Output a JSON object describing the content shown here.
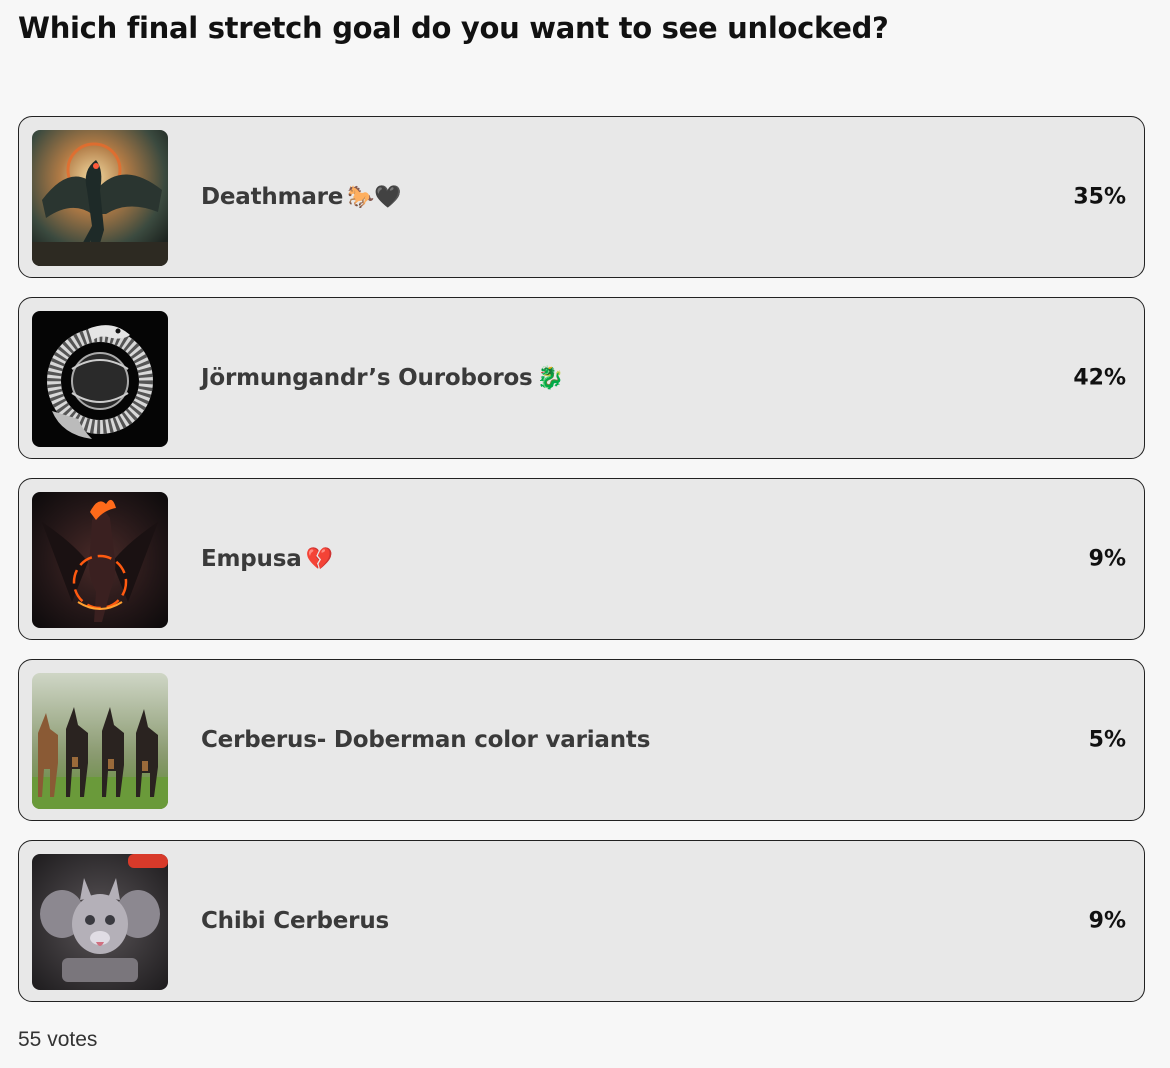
{
  "poll": {
    "question": "Which final stretch goal do you want to see unlocked?",
    "options": [
      {
        "label": "Deathmare",
        "emoji": "🐎🖤",
        "percent": "35%",
        "image": "winged-dark-horse-image"
      },
      {
        "label": "Jörmungandr’s Ouroboros",
        "emoji": "🐉",
        "percent": "42%",
        "image": "serpent-ouroboros-image"
      },
      {
        "label": "Empusa",
        "emoji": "💔",
        "percent": "9%",
        "image": "fiery-demon-woman-image"
      },
      {
        "label": "Cerberus- Doberman color variants",
        "emoji": "",
        "percent": "5%",
        "image": "doberman-dogs-image"
      },
      {
        "label": "Chibi Cerberus",
        "emoji": "",
        "percent": "9%",
        "image": "chibi-cerberus-figure-image"
      }
    ],
    "votes": "55 votes"
  }
}
